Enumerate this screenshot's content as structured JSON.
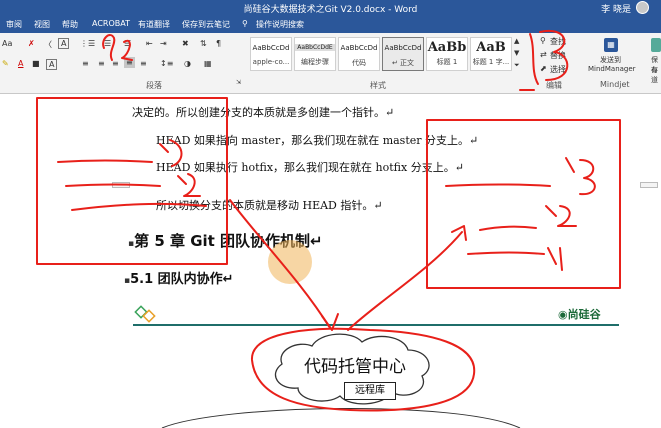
{
  "window": {
    "title": "尚硅谷大数据技术之Git V2.0.docx - Word",
    "user": "李 晓是"
  },
  "menu": {
    "items": [
      "审阅",
      "视图",
      "帮助",
      "ACROBAT",
      "有道翻译",
      "保存到云笔记",
      "操作说明搜索"
    ]
  },
  "ribbon": {
    "font_controls": {
      "size_label": "Aa",
      "a_label": "A"
    },
    "paragraph_group": "段落",
    "styles_group": "样式",
    "editing_group": "编辑",
    "mindjet_group": "Mindjet",
    "styles": [
      {
        "preview": "AaBbCcDd",
        "name": "apple-co..."
      },
      {
        "preview": "AaBbCcDdE",
        "name": "编程步骤"
      },
      {
        "preview": "AaBbCcDd",
        "name": "代码"
      },
      {
        "preview": "AaBbCcDd",
        "name": "↵ 正文"
      },
      {
        "preview": "AaBb",
        "name": "标题 1"
      },
      {
        "preview": "AaB",
        "name": "标题 1 字..."
      }
    ],
    "editing": {
      "find": "查找",
      "replace": "替换",
      "select": "选择"
    },
    "mindmanager": {
      "line1": "发送到",
      "line2": "MindManager"
    },
    "youdao_partial": {
      "line1": "保存",
      "line2": "有道"
    }
  },
  "document": {
    "lines": [
      "决定的。所以创建分支的本质就是多创建一个指针。↵",
      "HEAD 如果指向 master，那么我们现在就在 master 分支上。↵",
      "HEAD 如果执行 hotfix，那么我们现在就在 hotfix 分支上。↵",
      "所以切换分支的本质就是移动 HEAD 指针。↵"
    ],
    "chapter_heading": "第 5 章  Git 团队协作机制↵",
    "section_heading": "5.1  团队内协作↵",
    "logo_text": "尚硅谷",
    "diagram": {
      "cloud_label": "代码托管中心",
      "repo_label": "远程库"
    }
  },
  "annotations": {
    "color": "#e8201a",
    "handwritten": [
      "1",
      "3",
      "2",
      "1",
      "2",
      "3"
    ]
  },
  "colors": {
    "word_blue": "#2b579a",
    "teal_rule": "#1f6e6a",
    "pen_red": "#e8201a"
  }
}
